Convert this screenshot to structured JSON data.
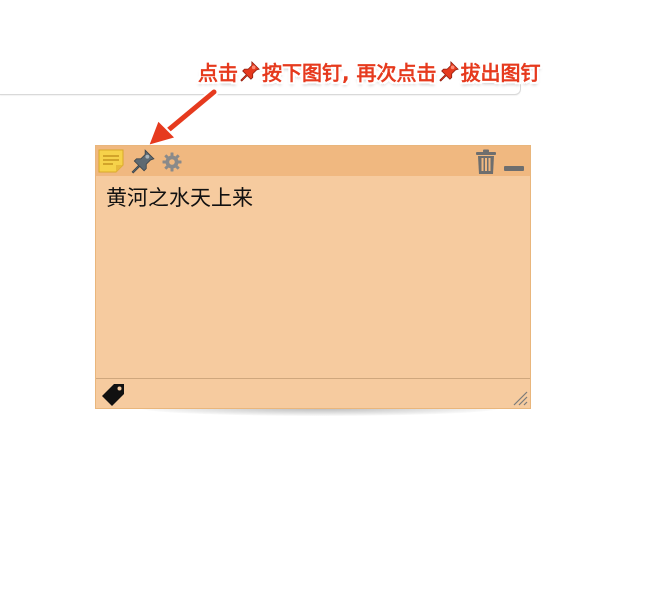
{
  "annotation": {
    "part1": "点击",
    "part2": "按下图钉, 再次点击",
    "part3": "拔出图钉"
  },
  "note": {
    "text": "黄河之水天上来",
    "icons": {
      "note": "sticky-note-icon",
      "pin": "pushpin-icon",
      "settings": "gear-icon",
      "delete": "trash-icon",
      "minimize": "minimize-icon",
      "tag": "tag-icon",
      "resize": "resize-grip-icon"
    }
  },
  "colors": {
    "note_background": "#f6cb9f",
    "note_header": "#f0b880",
    "annotation_red": "#e63a1e",
    "note_icon_yellow": "#f6d24a"
  }
}
